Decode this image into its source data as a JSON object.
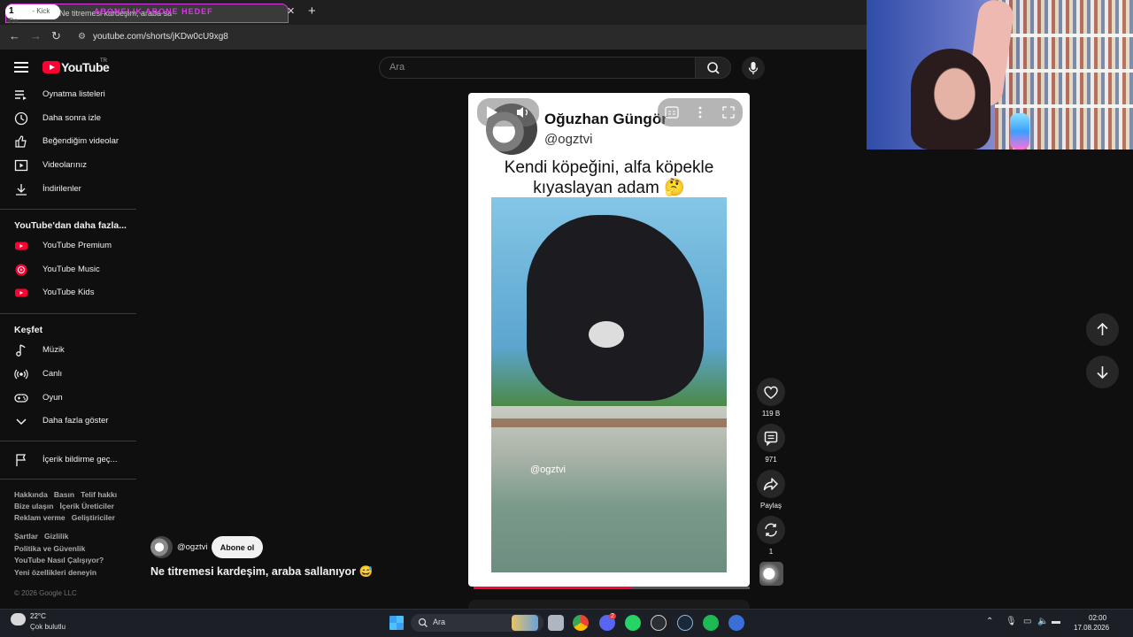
{
  "browser": {
    "tab_counter": "1",
    "tab_title_left": "- Kick Da",
    "tab_overlay_text": "ABONELIK ABONE HEDEF",
    "tab_title": "Ne titremesi kardeşim, araba sa",
    "url": "youtube.com/shorts/jKDw0cU9xg8"
  },
  "header": {
    "logo_text": "YouTube",
    "region": "TR",
    "search_placeholder": "Ara"
  },
  "sidebar": {
    "library": [
      {
        "label": "Oynatma listeleri",
        "icon": "playlist-icon"
      },
      {
        "label": "Daha sonra izle",
        "icon": "clock-icon"
      },
      {
        "label": "Beğendiğim videolar",
        "icon": "thumb-up-icon"
      },
      {
        "label": "Videolarınız",
        "icon": "video-icon"
      },
      {
        "label": "İndirilenler",
        "icon": "download-icon"
      }
    ],
    "more_title": "YouTube'dan daha fazla...",
    "more": [
      {
        "label": "YouTube Premium"
      },
      {
        "label": "YouTube Music"
      },
      {
        "label": "YouTube Kids"
      }
    ],
    "explore_title": "Keşfet",
    "explore": [
      {
        "label": "Müzik",
        "icon": "music-note-icon"
      },
      {
        "label": "Canlı",
        "icon": "live-icon"
      },
      {
        "label": "Oyun",
        "icon": "gamepad-icon"
      },
      {
        "label": "Daha fazla göster",
        "icon": "chevron-down-icon"
      }
    ],
    "report": "İçerik bildirme geç...",
    "footer": {
      "row1": [
        "Hakkında",
        "Basın",
        "Telif hakkı"
      ],
      "row2": [
        "Bize ulaşın",
        "İçerik Üreticiler"
      ],
      "row3": [
        "Reklam verme",
        "Geliştiriciler"
      ],
      "row4": [
        "Şartlar",
        "Gizlilik"
      ],
      "row5": "Politika ve Güvenlik",
      "row6": "YouTube Nasıl Çalışıyor?",
      "row7": "Yeni özellikleri deneyin",
      "copyright": "© 2026 Google LLC"
    }
  },
  "short": {
    "tweet_name": "Oğuzhan Güngör",
    "tweet_handle": "@ogztvi",
    "tweet_text": "Kendi köpeğini, alfa köpekle kıyaslayan adam 🤔",
    "watermark": "@ogztvi",
    "progress": 0.57,
    "channel_handle": "@ogztvi",
    "subscribe_label": "Abone ol",
    "caption": "Ne titremesi kardeşim, araba sallanıyor 😅"
  },
  "actions": {
    "likes": "119 B",
    "comments": "971",
    "share": "Paylaş",
    "remix": "1"
  },
  "taskbar": {
    "temperature": "22°C",
    "weather": "Çok bulutlu",
    "search": "Ara",
    "time": "02:00",
    "date": "17.08.2026",
    "discord_badge": "2"
  },
  "colors": {
    "accent_red": "#ff0033",
    "tab_outline": "#d63be0",
    "background": "#0f0f0f"
  }
}
